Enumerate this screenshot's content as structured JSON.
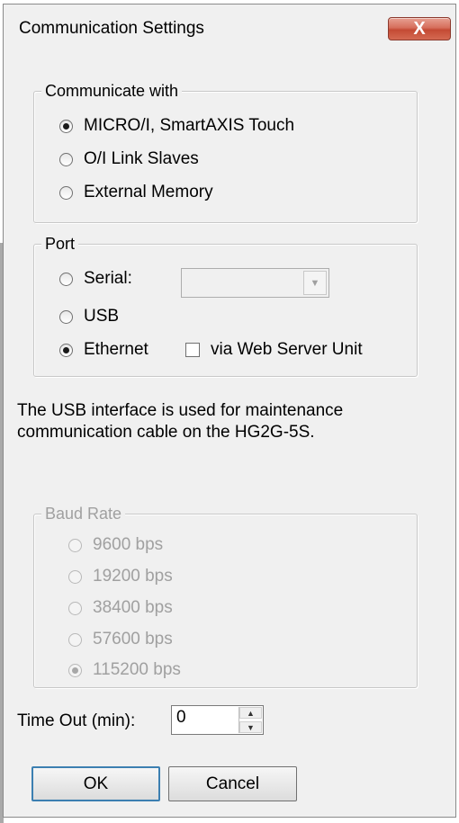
{
  "window": {
    "title": "Communication Settings",
    "close_label": "X"
  },
  "communicate_with": {
    "legend": "Communicate with",
    "options": [
      {
        "label": "MICRO/I, SmartAXIS Touch",
        "checked": true
      },
      {
        "label": "O/I Link Slaves",
        "checked": false
      },
      {
        "label": "External Memory",
        "checked": false
      }
    ]
  },
  "port": {
    "legend": "Port",
    "serial_label": "Serial:",
    "serial_value": "",
    "usb_label": "USB",
    "ethernet_label": "Ethernet",
    "selected": "Ethernet",
    "web_server_label": "via Web Server Unit",
    "web_server_checked": false
  },
  "info_text": {
    "line1": "The USB interface is used for maintenance",
    "line2": "communication cable on the HG2G-5S."
  },
  "baud_rate": {
    "legend": "Baud Rate",
    "enabled": false,
    "options": [
      {
        "label": "9600 bps",
        "checked": false
      },
      {
        "label": "19200 bps",
        "checked": false
      },
      {
        "label": "38400 bps",
        "checked": false
      },
      {
        "label": "57600 bps",
        "checked": false
      },
      {
        "label": "115200 bps",
        "checked": true
      }
    ]
  },
  "timeout": {
    "label": "Time Out (min):",
    "value": "0"
  },
  "buttons": {
    "ok": "OK",
    "cancel": "Cancel"
  }
}
